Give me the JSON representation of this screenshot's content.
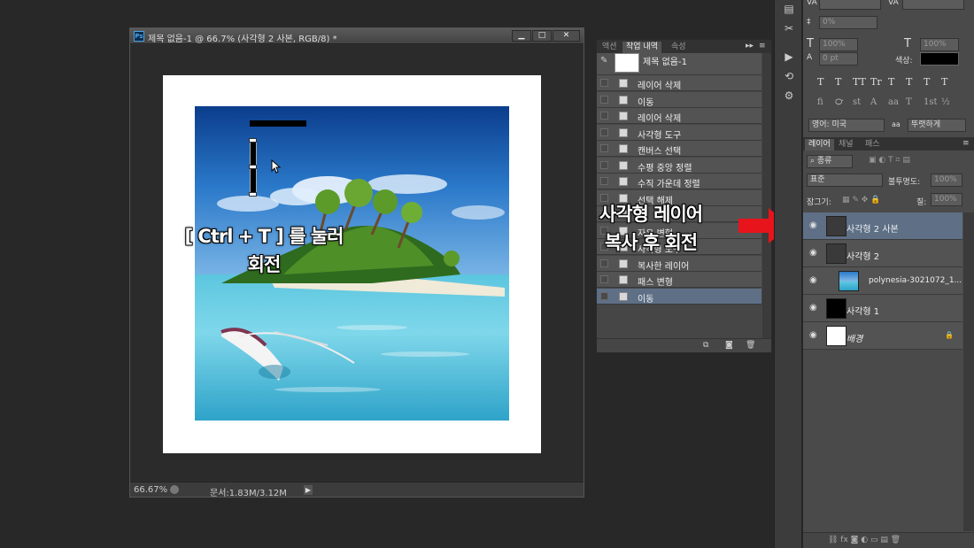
{
  "document": {
    "title": "제목 없음-1 @ 66.7% (사각형 2 사본, RGB/8) *",
    "ps_badge": "Ps",
    "zoom": "66.67%",
    "info": "문서:1.83M/3.12M",
    "buttons": {
      "min": "▁",
      "max": "□",
      "close": "✕"
    }
  },
  "history": {
    "tabs": [
      "액션",
      "작업 내역",
      "속성"
    ],
    "active_tab": 1,
    "snapshot_label": "제목 없음-1",
    "items": [
      "레이어 삭제",
      "이동",
      "레이어 삭제",
      "사각형 도구",
      "캔버스 선택",
      "수평 중앙 정렬",
      "수직 가운데 정렬",
      "선택 해제",
      "",
      "자유 변형",
      "사각형 도구",
      "복사한 레이어",
      "패스 변형",
      "이동"
    ]
  },
  "character": {
    "leading": "0%",
    "font_size_v": "100%",
    "font_size_h": "100%",
    "baseline": "0 pt",
    "color_label": "색상:",
    "language": "영어: 미국",
    "aa_prefix": "a",
    "aa_prefix2": "a",
    "antialias": "뚜렷하게",
    "type_styles": [
      "T",
      "T",
      "TT",
      "Tr",
      "T",
      "T",
      "T",
      "T"
    ],
    "opentype": [
      "fi",
      "℺",
      "st",
      "A",
      "aa",
      "T",
      "1st",
      "½"
    ]
  },
  "layers_panel": {
    "tabs": [
      "레이어",
      "채널",
      "패스"
    ],
    "filter_label": "종류",
    "blend_mode": "표준",
    "opacity_label": "불투명도:",
    "opacity": "100%",
    "lock_label": "잠그기:",
    "fill_label": "칠:",
    "fill": "100%",
    "layers": [
      {
        "name": "사각형 2 사본",
        "selected": true
      },
      {
        "name": "사각형 2",
        "selected": false
      },
      {
        "name": "polynesia-3021072_1...",
        "selected": false
      },
      {
        "name": "사각형 1",
        "selected": false
      },
      {
        "name": "배경",
        "selected": false
      }
    ]
  },
  "annotations": {
    "left_line1": "[ Ctrl + T ] 를 눌러",
    "left_line2": "회전",
    "right_line1": "사각형 레이어",
    "right_line2": "복사 후 회전"
  },
  "colors": {
    "arrow": "#e8141b",
    "selection": "#5e6f86",
    "accent": "#4aa3e6"
  }
}
